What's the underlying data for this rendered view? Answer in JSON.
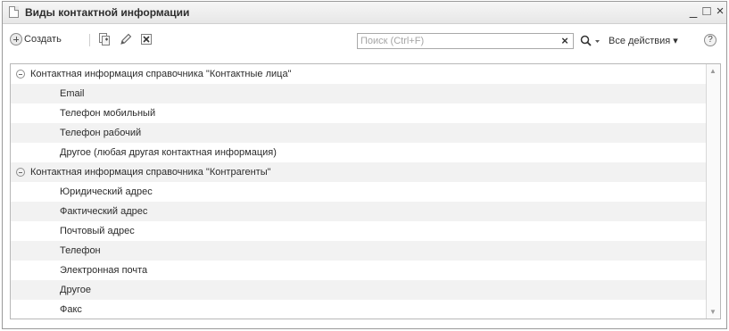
{
  "window": {
    "title": "Виды контактной информации",
    "minimize": "_",
    "maximize": "□",
    "close": "×"
  },
  "toolbar": {
    "create_label": "Создать",
    "search_placeholder": "Поиск (Ctrl+F)",
    "search_clear": "×",
    "all_actions_label": "Все действия ▾",
    "help_label": "?"
  },
  "icons": {
    "create": "plus-circle-icon",
    "copy": "copy-icon",
    "edit": "pencil-icon",
    "delete": "delete-mark-icon",
    "search": "magnifier-icon",
    "help": "question-icon"
  },
  "list": {
    "rows": [
      {
        "text": "Контактная информация справочника \"Контактные лица\"",
        "group": true
      },
      {
        "text": "Email",
        "group": false
      },
      {
        "text": "Телефон мобильный",
        "group": false
      },
      {
        "text": "Телефон рабочий",
        "group": false
      },
      {
        "text": "Другое (любая другая контактная информация)",
        "group": false
      },
      {
        "text": "Контактная информация справочника \"Контрагенты\"",
        "group": true
      },
      {
        "text": "Юридический адрес",
        "group": false
      },
      {
        "text": "Фактический адрес",
        "group": false
      },
      {
        "text": "Почтовый адрес",
        "group": false
      },
      {
        "text": "Телефон",
        "group": false
      },
      {
        "text": "Электронная почта",
        "group": false
      },
      {
        "text": "Другое",
        "group": false
      },
      {
        "text": "Факс",
        "group": false
      }
    ]
  },
  "colors": {
    "stripe": "#f2f2f2",
    "text": "#2b2b2b"
  }
}
